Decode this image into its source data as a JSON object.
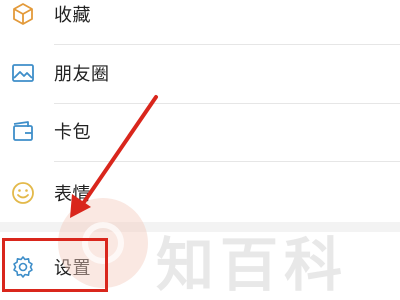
{
  "menu": {
    "items": [
      {
        "label": "收藏",
        "icon": "cube-icon"
      },
      {
        "label": "朋友圈",
        "icon": "image-icon"
      },
      {
        "label": "卡包",
        "icon": "card-icon"
      },
      {
        "label": "表情",
        "icon": "smile-icon"
      }
    ],
    "settings": {
      "label": "设置",
      "icon": "gear-icon"
    }
  },
  "watermark": {
    "text": "知百科"
  },
  "colors": {
    "icon_accent": "#3e8ec9",
    "icon_smile": "#e3b94a",
    "highlight": "#d9261c",
    "text": "#222222"
  }
}
